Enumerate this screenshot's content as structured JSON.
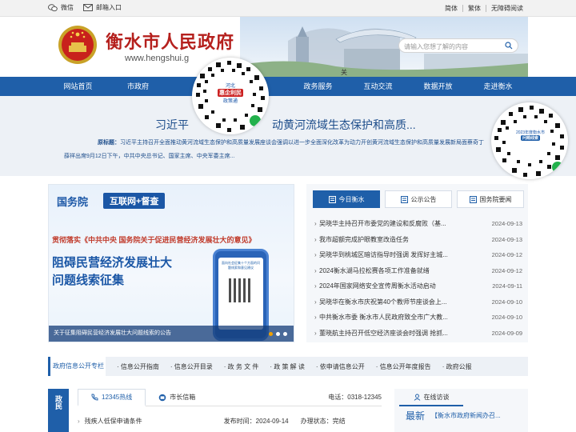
{
  "topbar": {
    "wechat_label": "微信",
    "mail_label": "邮箱入口",
    "simplified": "简体",
    "traditional": "繁体",
    "accessible": "无障碍阅读"
  },
  "header": {
    "title": "衡水市人民政府",
    "url": "www.hengshui.g",
    "search_placeholder": "请输入您想了解的内容",
    "close_label": "关闭"
  },
  "nav": {
    "items": [
      "网站首页",
      "市政府",
      "衡",
      "",
      "政务服务",
      "互动交流",
      "数据开放",
      "走进衡水"
    ]
  },
  "qr_float_1": {
    "title": "河北",
    "badge": "惠企利民",
    "sub": "政策通"
  },
  "qr_float_2": {
    "title": "2023年度衡水市",
    "badge": "问题线索"
  },
  "headline": {
    "left": "习近平",
    "right": "动黄河流域生态保护和高质...",
    "abstract_label": "原标题：",
    "abstract": "习近平主持召开全面推动黄河流域生态保护和高质量发展座谈会强调以进一步全面深化改革为动力开创黄河流域生态保护和高质量发展新局面蔡奇丁薛祥出席9月12日下午，中共中央总书记、国家主席、中央军委主席..."
  },
  "banner": {
    "org": "国务院",
    "tag": "互联网+督查",
    "line1": "贯彻落实《中共中央 国务院关于促进民营经济发展壮大的意见》",
    "line2": "阻碍民营经济发展壮大",
    "line3": "问题线索征集",
    "caption": "关于征集阻碍民营经济发展壮大问题线索的公告",
    "phone_text": "面向社会征集十个方面的问题线索和意见建议"
  },
  "news": {
    "tabs": [
      "今日衡水",
      "公示公告",
      "国务院要闻"
    ],
    "items": [
      {
        "title": "吴晓华主持召开市委党的建设和反腐败（基...",
        "date": "2024-09-13"
      },
      {
        "title": "我市超额完成护眼教室改造任务",
        "date": "2024-09-13"
      },
      {
        "title": "吴晓华到桃城区暗访指导时强调 发挥好主城...",
        "date": "2024-09-12"
      },
      {
        "title": "2024衡水湖马拉松赛各项工作准备就绪",
        "date": "2024-09-12"
      },
      {
        "title": "2024年国家网络安全宣传周衡水活动启动",
        "date": "2024-09-11"
      },
      {
        "title": "吴晓华在衡水市庆祝第40个教师节座谈会上...",
        "date": "2024-09-10"
      },
      {
        "title": "中共衡水市委 衡水市人民政府致全市广大教...",
        "date": "2024-09-10"
      },
      {
        "title": "董晓航主持召开低空经济座谈会时强调 抢抓...",
        "date": "2024-09-09"
      }
    ]
  },
  "disclosure": {
    "header": "政府信息公开专栏",
    "items": [
      "· 信息公开指南",
      "· 信息公开目录",
      "· 政 务 文 件",
      "· 政 策 解 读",
      "· 依申请信息公开",
      "· 信息公开年度报告",
      "· 政府公报"
    ]
  },
  "bottom": {
    "side_label": "政民",
    "hotline_tab": "12345热线",
    "mailbox_tab": "市长信箱",
    "phone_label": "电话：0318-12345",
    "row": {
      "title": "残疾人低保申请条件",
      "date": "发布时间：2024-09-14",
      "status": "办理状态：完结"
    },
    "online_tab": "在线访谈",
    "latest": "最新",
    "online_title": "【衡水市政府新闻办召..."
  }
}
